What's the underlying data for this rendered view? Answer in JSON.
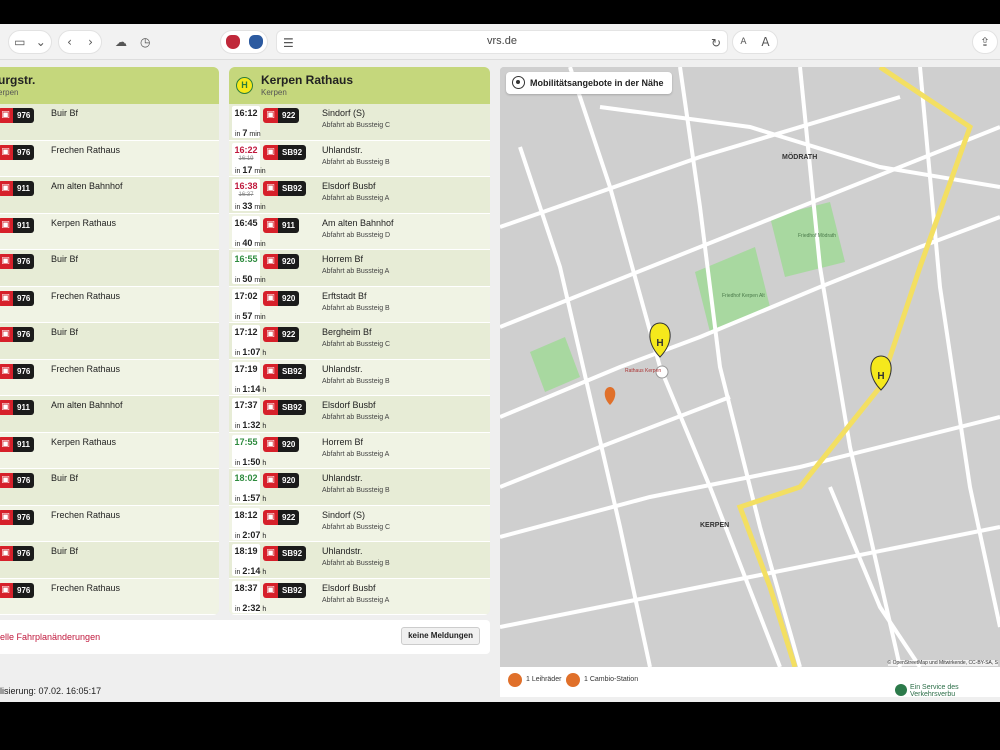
{
  "browser": {
    "url": "vrs.de",
    "icons": [
      "sidebar-icon",
      "chevron-down-icon",
      "back-icon",
      "forward-icon",
      "cloud-icon",
      "history-icon",
      "reload-icon",
      "share-icon"
    ],
    "text_small": "A",
    "text_large": "A"
  },
  "left_panel": {
    "title": "urgstr.",
    "subtitle": "erpen",
    "rows": [
      {
        "line": "976",
        "dest": "Buir Bf"
      },
      {
        "line": "976",
        "dest": "Frechen Rathaus"
      },
      {
        "line": "911",
        "dest": "Am alten Bahnhof"
      },
      {
        "line": "911",
        "dest": "Kerpen Rathaus"
      },
      {
        "line": "976",
        "dest": "Buir Bf"
      },
      {
        "line": "976",
        "dest": "Frechen Rathaus"
      },
      {
        "line": "976",
        "dest": "Buir Bf"
      },
      {
        "line": "976",
        "dest": "Frechen Rathaus"
      },
      {
        "line": "911",
        "dest": "Am alten Bahnhof"
      },
      {
        "line": "911",
        "dest": "Kerpen Rathaus"
      },
      {
        "line": "976",
        "dest": "Buir Bf"
      },
      {
        "line": "976",
        "dest": "Frechen Rathaus"
      },
      {
        "line": "976",
        "dest": "Buir Bf"
      },
      {
        "line": "976",
        "dest": "Frechen Rathaus"
      }
    ]
  },
  "right_panel": {
    "badge": "H",
    "title": "Kerpen Rathaus",
    "subtitle": "Kerpen",
    "rows": [
      {
        "time": "16:12",
        "status": "normal",
        "sched": "",
        "wait_pre": "in",
        "wait_num": "7",
        "wait_unit": "min",
        "line": "922",
        "dest": "Sindorf (S)",
        "stop": "Abfahrt ab Bussteig C"
      },
      {
        "time": "16:22",
        "status": "late",
        "sched": "16:19",
        "wait_pre": "in",
        "wait_num": "17",
        "wait_unit": "min",
        "line": "SB92",
        "dest": "Uhlandstr.",
        "stop": "Abfahrt ab Bussteig B"
      },
      {
        "time": "16:38",
        "status": "late",
        "sched": "16:37",
        "wait_pre": "in",
        "wait_num": "33",
        "wait_unit": "min",
        "line": "SB92",
        "dest": "Elsdorf Busbf",
        "stop": "Abfahrt ab Bussteig A"
      },
      {
        "time": "16:45",
        "status": "normal",
        "sched": "",
        "wait_pre": "in",
        "wait_num": "40",
        "wait_unit": "min",
        "line": "911",
        "dest": "Am alten Bahnhof",
        "stop": "Abfahrt ab Bussteig D"
      },
      {
        "time": "16:55",
        "status": "green",
        "sched": "",
        "wait_pre": "in",
        "wait_num": "50",
        "wait_unit": "min",
        "line": "920",
        "dest": "Horrem Bf",
        "stop": "Abfahrt ab Bussteig A"
      },
      {
        "time": "17:02",
        "status": "normal",
        "sched": "",
        "wait_pre": "in",
        "wait_num": "57",
        "wait_unit": "min",
        "line": "920",
        "dest": "Erftstadt Bf",
        "stop": "Abfahrt ab Bussteig B"
      },
      {
        "time": "17:12",
        "status": "normal",
        "sched": "",
        "wait_pre": "in",
        "wait_num": "1:07",
        "wait_unit": "h",
        "line": "922",
        "dest": "Bergheim Bf",
        "stop": "Abfahrt ab Bussteig C"
      },
      {
        "time": "17:19",
        "status": "normal",
        "sched": "",
        "wait_pre": "in",
        "wait_num": "1:14",
        "wait_unit": "h",
        "line": "SB92",
        "dest": "Uhlandstr.",
        "stop": "Abfahrt ab Bussteig B"
      },
      {
        "time": "17:37",
        "status": "normal",
        "sched": "",
        "wait_pre": "in",
        "wait_num": "1:32",
        "wait_unit": "h",
        "line": "SB92",
        "dest": "Elsdorf Busbf",
        "stop": "Abfahrt ab Bussteig A"
      },
      {
        "time": "17:55",
        "status": "green",
        "sched": "",
        "wait_pre": "in",
        "wait_num": "1:50",
        "wait_unit": "h",
        "line": "920",
        "dest": "Horrem Bf",
        "stop": "Abfahrt ab Bussteig A"
      },
      {
        "time": "18:02",
        "status": "green",
        "sched": "",
        "wait_pre": "in",
        "wait_num": "1:57",
        "wait_unit": "h",
        "line": "920",
        "dest": "Uhlandstr.",
        "stop": "Abfahrt ab Bussteig B"
      },
      {
        "time": "18:12",
        "status": "normal",
        "sched": "",
        "wait_pre": "in",
        "wait_num": "2:07",
        "wait_unit": "h",
        "line": "922",
        "dest": "Sindorf (S)",
        "stop": "Abfahrt ab Bussteig C"
      },
      {
        "time": "18:19",
        "status": "normal",
        "sched": "",
        "wait_pre": "in",
        "wait_num": "2:14",
        "wait_unit": "h",
        "line": "SB92",
        "dest": "Uhlandstr.",
        "stop": "Abfahrt ab Bussteig B"
      },
      {
        "time": "18:37",
        "status": "normal",
        "sched": "",
        "wait_pre": "in",
        "wait_num": "2:32",
        "wait_unit": "h",
        "line": "SB92",
        "dest": "Elsdorf Busbf",
        "stop": "Abfahrt ab Bussteig A"
      }
    ]
  },
  "changes": {
    "label": "elle Fahrplanänderungen",
    "button": "keine Meldungen"
  },
  "map": {
    "button": "Mobilitätsangebote in der Nähe",
    "labels": {
      "modrath": "MÖDRATH",
      "kerpen": "KERPEN",
      "friedhof": "Friedhof Kerpen Alt",
      "friedhof2": "Friedhof Mödrath",
      "rathaus": "Rathaus Kerpen",
      "stop_badge": "H"
    },
    "attribution": "© OpenStreetMap und Mitwirkende, CC-BY-SA, S",
    "footer": {
      "bikes": "1 Leihräder",
      "cambio": "1 Cambio-Station"
    }
  },
  "footer": {
    "updated": "lisierung: 07.02. 16:05:17",
    "service": "Ein Service des Verkehrsverbu"
  },
  "colors": {
    "header_green": "#c5d77c",
    "panel_bg": "#e7ecd6",
    "late": "#c0183c",
    "on_time": "#2e8b3e",
    "bus_red": "#d6202a",
    "road_yellow": "#f3df62"
  }
}
